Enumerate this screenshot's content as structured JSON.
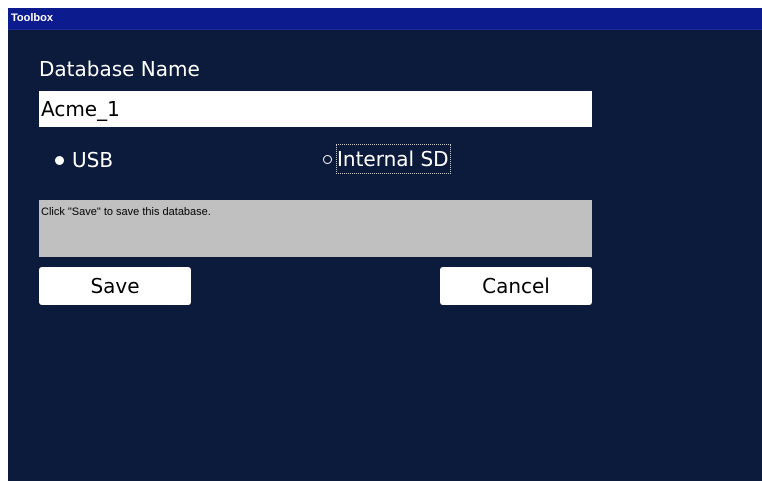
{
  "window": {
    "title": "Toolbox"
  },
  "form": {
    "database_label": "Database Name",
    "database_value": "Acme_1",
    "storage_options": [
      {
        "label": "USB",
        "selected": true
      },
      {
        "label": "Internal SD",
        "selected": false
      }
    ],
    "message": "Click \"Save\" to save this database.",
    "save_label": "Save",
    "cancel_label": "Cancel"
  },
  "colors": {
    "window_background": "#0c1a3c",
    "titlebar": "#0c1c8e",
    "message_box": "#c0c0c0"
  }
}
